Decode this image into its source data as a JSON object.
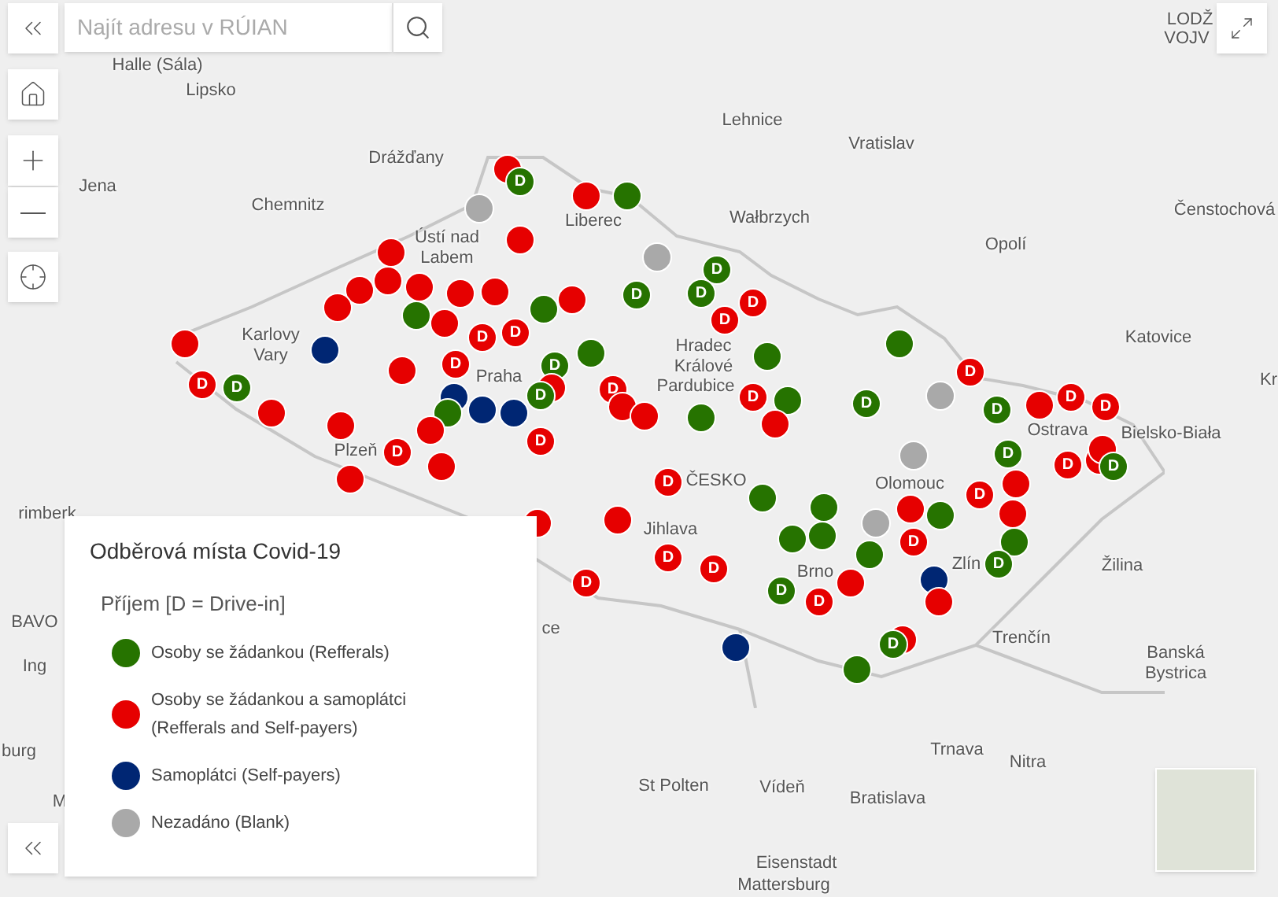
{
  "search": {
    "placeholder": "Najít adresu v RÚIAN"
  },
  "places": [
    {
      "name": "LODŽ"
    },
    {
      "name": "VOJV"
    },
    {
      "name": "Halle (Sála)"
    },
    {
      "name": "Lipsko"
    },
    {
      "name": "Drážďany"
    },
    {
      "name": "Jena"
    },
    {
      "name": "Chemnitz"
    },
    {
      "name": "Ústí nad Labem"
    },
    {
      "name": "Liberec"
    },
    {
      "name": "Lehnice"
    },
    {
      "name": "Vratislav"
    },
    {
      "name": "Wałbrzych"
    },
    {
      "name": "Opolí"
    },
    {
      "name": "Čenstochová"
    },
    {
      "name": "Katovice"
    },
    {
      "name": "Kr"
    },
    {
      "name": "Karlovy Vary"
    },
    {
      "name": "Praha"
    },
    {
      "name": "Plzeň"
    },
    {
      "name": "Hradec Králové"
    },
    {
      "name": "Pardubice"
    },
    {
      "name": "ČESKO"
    },
    {
      "name": "Ostrava"
    },
    {
      "name": "Bielsko-Biała"
    },
    {
      "name": "Olomouc"
    },
    {
      "name": "Jihlava"
    },
    {
      "name": "Brno"
    },
    {
      "name": "Zlín"
    },
    {
      "name": "Žilina"
    },
    {
      "name": "Trenčín"
    },
    {
      "name": "Banská Bystrica"
    },
    {
      "name": "Trnava"
    },
    {
      "name": "Nitra"
    },
    {
      "name": "St Polten"
    },
    {
      "name": "Vídeň"
    },
    {
      "name": "Bratislava"
    },
    {
      "name": "Eisenstadt"
    },
    {
      "name": "Mattersburg"
    },
    {
      "name": "rimberk"
    },
    {
      "name": "BAVO"
    },
    {
      "name": "Ing"
    },
    {
      "name": "burg"
    },
    {
      "name": "M"
    },
    {
      "name": "ce"
    }
  ],
  "markers": [
    {
      "color": "#e60000"
    },
    {
      "color": "#267300",
      "label": "D"
    },
    {
      "color": "#a9a9a9"
    },
    {
      "color": "#e60000"
    },
    {
      "color": "#267300"
    },
    {
      "color": "#a9a9a9"
    },
    {
      "color": "#267300",
      "label": "D"
    },
    {
      "color": "#e60000"
    },
    {
      "color": "#e60000"
    },
    {
      "color": "#e60000"
    },
    {
      "color": "#e60000"
    },
    {
      "color": "#e60000"
    },
    {
      "color": "#e60000"
    },
    {
      "color": "#e60000"
    },
    {
      "color": "#267300"
    },
    {
      "color": "#e60000"
    },
    {
      "color": "#267300"
    },
    {
      "color": "#e60000"
    },
    {
      "color": "#267300",
      "label": "D"
    },
    {
      "color": "#267300",
      "label": "D"
    },
    {
      "color": "#e60000",
      "label": "D"
    },
    {
      "color": "#e60000"
    },
    {
      "color": "#e60000",
      "label": "D"
    },
    {
      "color": "#267300",
      "label": "D"
    },
    {
      "color": "#e60000"
    },
    {
      "color": "#002673"
    },
    {
      "color": "#e60000"
    },
    {
      "color": "#e60000"
    },
    {
      "color": "#e60000",
      "label": "D"
    },
    {
      "color": "#e60000",
      "label": "D"
    },
    {
      "color": "#267300"
    },
    {
      "color": "#002673"
    },
    {
      "color": "#002673"
    },
    {
      "color": "#002673"
    },
    {
      "color": "#e60000",
      "label": "D"
    },
    {
      "color": "#267300",
      "label": "D"
    },
    {
      "color": "#e60000"
    },
    {
      "color": "#267300"
    },
    {
      "color": "#267300",
      "label": "D"
    },
    {
      "color": "#e60000"
    },
    {
      "color": "#e60000"
    },
    {
      "color": "#e60000"
    },
    {
      "color": "#e60000",
      "label": "D"
    },
    {
      "color": "#e60000"
    },
    {
      "color": "#e60000",
      "label": "D"
    },
    {
      "color": "#e60000",
      "label": "D"
    },
    {
      "color": "#e60000"
    },
    {
      "color": "#e60000"
    },
    {
      "color": "#e60000",
      "label": "D"
    },
    {
      "color": "#267300"
    },
    {
      "color": "#e60000",
      "label": "D"
    },
    {
      "color": "#267300"
    },
    {
      "color": "#267300"
    },
    {
      "color": "#e60000"
    },
    {
      "color": "#267300",
      "label": "D"
    },
    {
      "color": "#267300"
    },
    {
      "color": "#a9a9a9"
    },
    {
      "color": "#e60000",
      "label": "D"
    },
    {
      "color": "#267300",
      "label": "D"
    },
    {
      "color": "#a9a9a9"
    },
    {
      "color": "#e60000"
    },
    {
      "color": "#a9a9a9"
    },
    {
      "color": "#267300"
    },
    {
      "color": "#267300",
      "label": "D"
    },
    {
      "color": "#e60000"
    },
    {
      "color": "#e60000",
      "label": "D"
    },
    {
      "color": "#e60000"
    },
    {
      "color": "#e60000",
      "label": "D"
    },
    {
      "color": "#e60000",
      "label": "D"
    },
    {
      "color": "#e60000"
    },
    {
      "color": "#267300",
      "label": "D"
    },
    {
      "color": "#e60000"
    },
    {
      "color": "#e60000"
    },
    {
      "color": "#267300"
    },
    {
      "color": "#e60000",
      "label": "D"
    },
    {
      "color": "#e60000",
      "label": "D"
    },
    {
      "color": "#267300"
    },
    {
      "color": "#267300"
    },
    {
      "color": "#267300"
    },
    {
      "color": "#267300"
    },
    {
      "color": "#267300"
    },
    {
      "color": "#e60000",
      "label": "D"
    },
    {
      "color": "#e60000"
    },
    {
      "color": "#e60000",
      "label": "D"
    },
    {
      "color": "#e60000"
    },
    {
      "color": "#e60000",
      "label": "D"
    },
    {
      "color": "#e60000",
      "label": "D"
    },
    {
      "color": "#e60000"
    },
    {
      "color": "#e60000",
      "label": "D"
    },
    {
      "color": "#267300",
      "label": "D"
    },
    {
      "color": "#002673"
    },
    {
      "color": "#267300",
      "label": "D"
    },
    {
      "color": "#e60000"
    },
    {
      "color": "#e60000"
    },
    {
      "color": "#267300",
      "label": "D"
    },
    {
      "color": "#002673"
    },
    {
      "color": "#267300"
    }
  ],
  "legend": {
    "title": "Odběrová místa Covid-19",
    "subtitle": "Příjem [D = Drive-in]",
    "items": [
      {
        "label": "Osoby se žádankou (Refferals)",
        "color": "#267300"
      },
      {
        "label": "Osoby se žádankou a samoplátci (Refferals and Self-payers)",
        "color": "#e60000"
      },
      {
        "label": "Samoplátci (Self-payers)",
        "color": "#002673"
      },
      {
        "label": "Nezadáno (Blank)",
        "color": "#a9a9a9"
      }
    ]
  }
}
